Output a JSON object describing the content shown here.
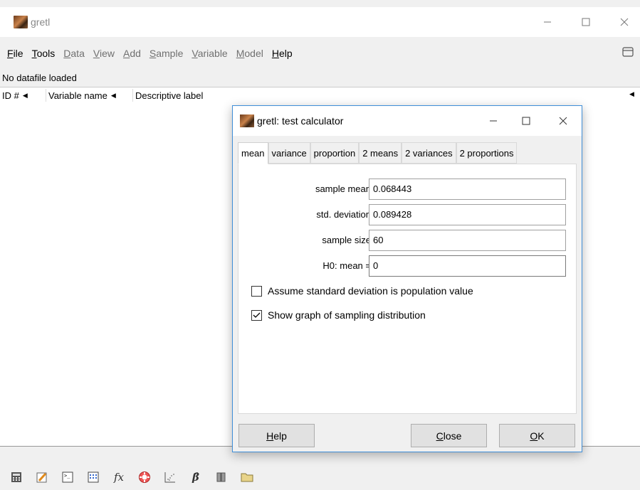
{
  "window": {
    "title": "gretl"
  },
  "menu": {
    "items": [
      {
        "label": "File",
        "accel": "F",
        "rest": "ile",
        "enabled": true
      },
      {
        "label": "Tools",
        "accel": "T",
        "rest": "ools",
        "enabled": true
      },
      {
        "label": "Data",
        "accel": "D",
        "rest": "ata",
        "enabled": false
      },
      {
        "label": "View",
        "accel": "V",
        "rest": "iew",
        "enabled": false
      },
      {
        "label": "Add",
        "accel": "A",
        "rest": "dd",
        "enabled": false
      },
      {
        "label": "Sample",
        "accel": "S",
        "rest": "ample",
        "enabled": false
      },
      {
        "label": "Variable",
        "accel": "V",
        "rest": "ariable",
        "enabled": false
      },
      {
        "label": "Model",
        "accel": "M",
        "rest": "odel",
        "enabled": false
      },
      {
        "label": "Help",
        "accel": "H",
        "rest": "elp",
        "enabled": true
      }
    ]
  },
  "status_text": "No datafile loaded",
  "columns": {
    "id": "ID #",
    "varname": "Variable name",
    "label": "Descriptive label"
  },
  "toolbar_icons": [
    "calculator-icon",
    "edit-icon",
    "console-icon",
    "session-icon",
    "function-icon",
    "help-icon",
    "scatter-plot-icon",
    "beta-icon",
    "database-icon",
    "folder-icon"
  ],
  "dialog": {
    "title": "gretl: test calculator",
    "tabs": [
      "mean",
      "variance",
      "proportion",
      "2 means",
      "2 variances",
      "2 proportions"
    ],
    "active_tab": "mean",
    "fields": [
      {
        "label": "sample mean",
        "value": "0.068443"
      },
      {
        "label": "std. deviation",
        "value": "0.089428"
      },
      {
        "label": "sample size",
        "value": "60"
      },
      {
        "label": "H0: mean =",
        "value": "0"
      }
    ],
    "checks": [
      {
        "label": "Assume standard deviation is population value",
        "checked": false
      },
      {
        "label": "Show graph of sampling distribution",
        "checked": true
      }
    ],
    "buttons": {
      "help": {
        "accel": "H",
        "rest": "elp"
      },
      "close": {
        "accel": "C",
        "rest": "lose"
      },
      "ok": {
        "accel": "O",
        "rest": "K"
      }
    }
  }
}
